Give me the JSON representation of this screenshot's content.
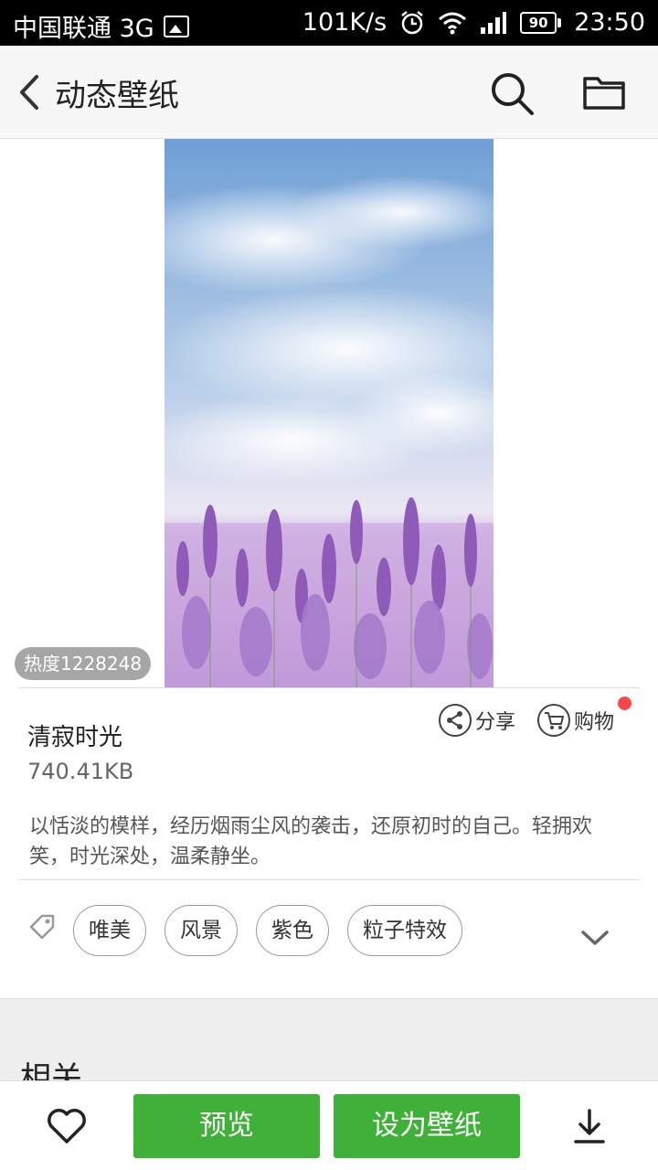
{
  "status_bar": {
    "carrier": "中国联通 3G",
    "speed": "101K/s",
    "battery": "90",
    "time": "23:50"
  },
  "header": {
    "title": "动态壁纸"
  },
  "wallpaper": {
    "heat": "热度1228248",
    "name": "清寂时光",
    "size": "740.41KB",
    "description": "以恬淡的模样，经历烟雨尘风的袭击，还原初时的自己。轻拥欢笑，时光深处，温柔静坐。"
  },
  "actions": {
    "share_label": "分享",
    "shop_label": "购物"
  },
  "tags": [
    "唯美",
    "风景",
    "紫色",
    "粒子特效"
  ],
  "related": {
    "title": "相关"
  },
  "bottom": {
    "preview_label": "预览",
    "set_label": "设为壁纸"
  },
  "colors": {
    "accent_green": "#3fb138",
    "badge_red": "#f24a4a"
  }
}
